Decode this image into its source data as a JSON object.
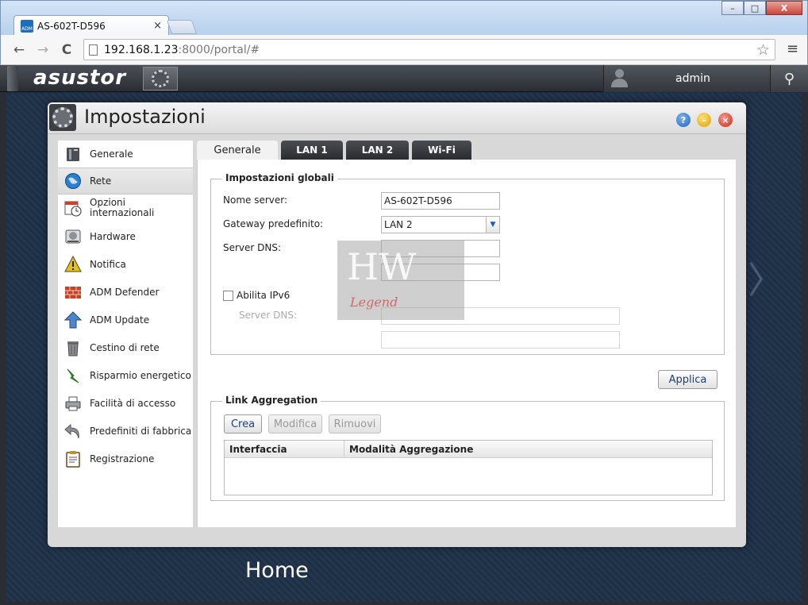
{
  "browser": {
    "tab_title": "AS-602T-D596",
    "tab_close": "×",
    "favicon_text": "ADM",
    "url_host": "192.168.1.23",
    "url_rest": ":8000/portal/#",
    "back": "←",
    "forward": "→",
    "reload": "C",
    "star": "☆",
    "menu": "≡",
    "win_min": "–",
    "win_max": "□",
    "win_close": "X"
  },
  "topbar": {
    "logo": "asustor",
    "user": "admin",
    "search_glyph": "🔍"
  },
  "window": {
    "title": "Impostazioni",
    "help": "?",
    "minimize": "–",
    "close": "×"
  },
  "sidebar": {
    "items": [
      {
        "label": "Generale",
        "icon": "server-icon"
      },
      {
        "label": "Rete",
        "icon": "globe-icon"
      },
      {
        "label": "Opzioni internazionali",
        "icon": "calendar-clock-icon"
      },
      {
        "label": "Hardware",
        "icon": "hard-drive-icon"
      },
      {
        "label": "Notifica",
        "icon": "warning-icon"
      },
      {
        "label": "ADM Defender",
        "icon": "firewall-icon"
      },
      {
        "label": "ADM Update",
        "icon": "up-arrow-icon"
      },
      {
        "label": "Cestino di rete",
        "icon": "trash-icon"
      },
      {
        "label": "Risparmio energetico",
        "icon": "energy-icon"
      },
      {
        "label": "Facilità di accesso",
        "icon": "printer-icon"
      },
      {
        "label": "Predefiniti di fabbrica",
        "icon": "undo-icon"
      },
      {
        "label": "Registrazione",
        "icon": "clipboard-icon"
      }
    ],
    "active": "Rete"
  },
  "tabs": [
    "Generale",
    "LAN 1",
    "LAN 2",
    "Wi-Fi"
  ],
  "general": {
    "legend": "Impostazioni globali",
    "server_name_label": "Nome server:",
    "server_name_value": "AS-602T-D596",
    "gateway_label": "Gateway predefinito:",
    "gateway_value": "LAN 2",
    "dns_label": "Server DNS:",
    "dns1": "",
    "dns2": "",
    "ipv6_label": "Abilita IPv6",
    "ipv6_checked": false,
    "ipv6_dns_label": "Server DNS:",
    "ipv6_dns1": "",
    "ipv6_dns2": "",
    "apply": "Applica"
  },
  "link_aggregation": {
    "legend": "Link Aggregation",
    "create": "Crea",
    "modify": "Modifica",
    "remove": "Rimuovi",
    "columns": [
      "Interfaccia",
      "Modalità Aggregazione"
    ],
    "rows": []
  },
  "watermark": {
    "hw": "HW",
    "legend": "Legend"
  },
  "desktop": {
    "home": "Home",
    "next_arrow": "〉"
  },
  "colors": {
    "tab_dark": "#2f3236",
    "link_blue": "#1c3f78",
    "desktop_bg": "#1e2f45"
  }
}
